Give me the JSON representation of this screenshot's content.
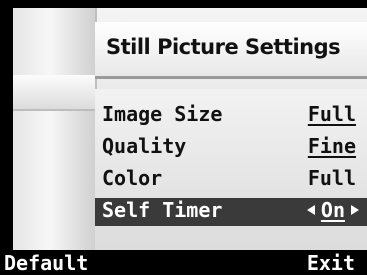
{
  "menu": {
    "title": "Still Picture Settings",
    "items": [
      {
        "label": "Image Size",
        "value": "Full"
      },
      {
        "label": "Quality",
        "value": "Fine"
      },
      {
        "label": "Color",
        "value": "Full"
      },
      {
        "label": "Self Timer",
        "value": "On"
      }
    ]
  },
  "footer": {
    "left_label": "Default",
    "right_label": "Exit"
  },
  "colors": {
    "background": "#000000",
    "selected_row": "#3a3a3a",
    "text_dark": "#111111",
    "text_light": "#ffffff"
  }
}
